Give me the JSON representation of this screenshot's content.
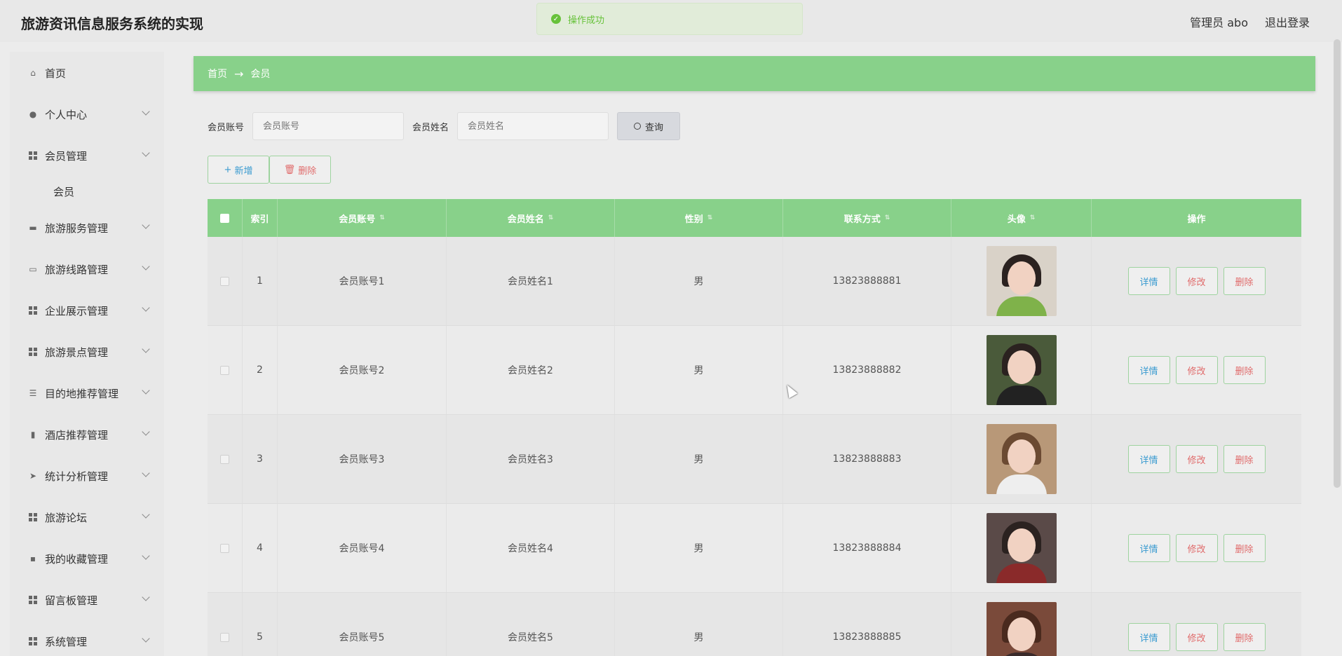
{
  "header": {
    "title": "旅游资讯信息服务系统的实现",
    "user_label": "管理员 abo",
    "logout_label": "退出登录"
  },
  "toast": {
    "message": "操作成功",
    "icon": "check-circle-icon",
    "color": "#67c23a"
  },
  "sidebar": {
    "items": [
      {
        "label": "首页",
        "icon": "home-icon",
        "expandable": false
      },
      {
        "label": "个人中心",
        "icon": "user-icon",
        "expandable": true
      },
      {
        "label": "会员管理",
        "icon": "grid-icon",
        "expandable": true
      },
      {
        "label": "会员",
        "icon": "",
        "expandable": false,
        "sub": true
      },
      {
        "label": "旅游服务管理",
        "icon": "printer-icon",
        "expandable": true
      },
      {
        "label": "旅游线路管理",
        "icon": "briefcase-icon",
        "expandable": true
      },
      {
        "label": "企业展示管理",
        "icon": "grid-icon",
        "expandable": true
      },
      {
        "label": "旅游景点管理",
        "icon": "grid-icon",
        "expandable": true
      },
      {
        "label": "目的地推荐管理",
        "icon": "sliders-icon",
        "expandable": true
      },
      {
        "label": "酒店推荐管理",
        "icon": "bar-chart-icon",
        "expandable": true
      },
      {
        "label": "统计分析管理",
        "icon": "send-icon",
        "expandable": true
      },
      {
        "label": "旅游论坛",
        "icon": "grid-icon",
        "expandable": true
      },
      {
        "label": "我的收藏管理",
        "icon": "message-icon",
        "expandable": true
      },
      {
        "label": "留言板管理",
        "icon": "grid-icon",
        "expandable": true
      },
      {
        "label": "系统管理",
        "icon": "grid-icon",
        "expandable": true
      }
    ]
  },
  "breadcrumb": {
    "home": "首页",
    "arrow": "→",
    "current": "会员"
  },
  "search": {
    "account_label": "会员账号",
    "account_placeholder": "会员账号",
    "name_label": "会员姓名",
    "name_placeholder": "会员姓名",
    "query_label": "查询"
  },
  "actions": {
    "add_label": "新增",
    "delete_label": "删除"
  },
  "table": {
    "headers": [
      "",
      "索引",
      "会员账号",
      "会员姓名",
      "性别",
      "联系方式",
      "头像",
      "操作"
    ],
    "rows": [
      {
        "index": "1",
        "account": "会员账号1",
        "name": "会员姓名1",
        "gender": "男",
        "phone": "13823888881"
      },
      {
        "index": "2",
        "account": "会员账号2",
        "name": "会员姓名2",
        "gender": "男",
        "phone": "13823888882"
      },
      {
        "index": "3",
        "account": "会员账号3",
        "name": "会员姓名3",
        "gender": "男",
        "phone": "13823888883"
      },
      {
        "index": "4",
        "account": "会员账号4",
        "name": "会员姓名4",
        "gender": "男",
        "phone": "13823888884"
      },
      {
        "index": "5",
        "account": "会员账号5",
        "name": "会员姓名5",
        "gender": "男",
        "phone": "13823888885"
      }
    ],
    "row_actions": {
      "detail": "详情",
      "edit": "修改",
      "delete": "删除"
    }
  },
  "colors": {
    "accent": "#88d18a",
    "danger": "#e06b6b",
    "info": "#3a9bd0"
  }
}
